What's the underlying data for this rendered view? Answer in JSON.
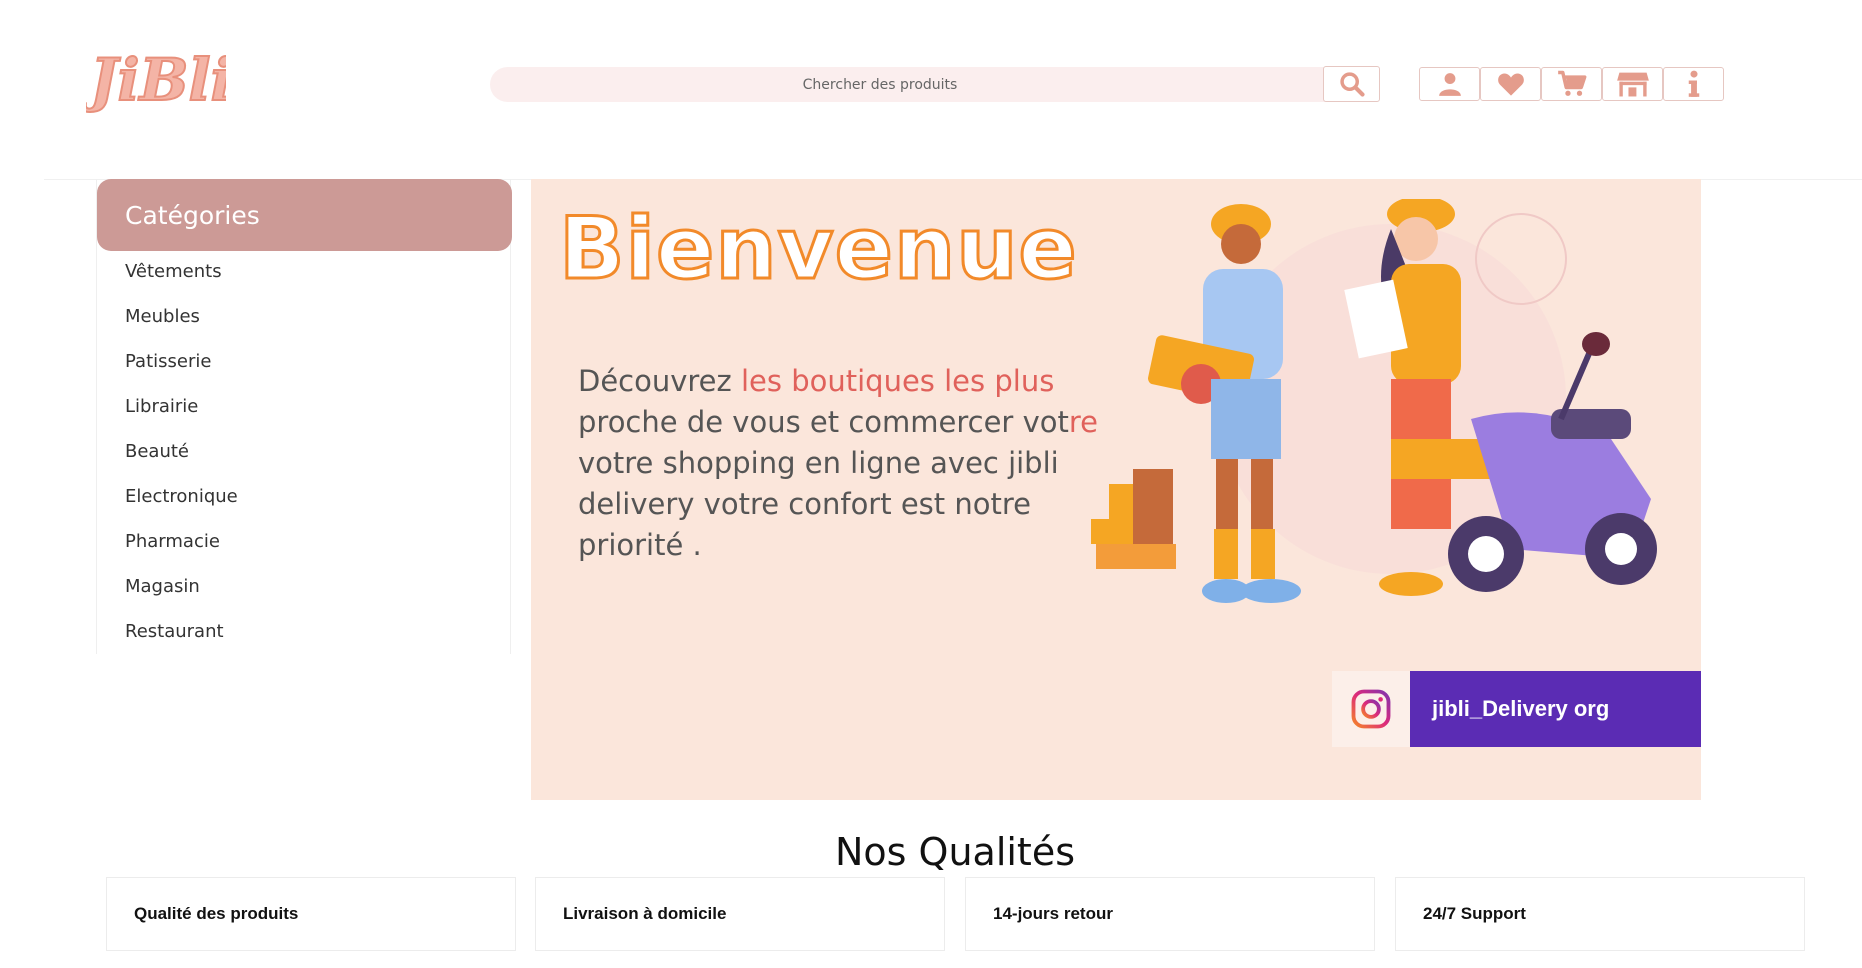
{
  "header": {
    "logo_text": "JiBli",
    "search_placeholder": "Chercher des produits",
    "icons": [
      "search-icon",
      "user-icon",
      "heart-icon",
      "cart-icon",
      "store-icon",
      "info-icon"
    ]
  },
  "sidebar": {
    "title": "Catégories",
    "items": [
      {
        "label": "Vêtements"
      },
      {
        "label": "Meubles"
      },
      {
        "label": "Patisserie"
      },
      {
        "label": "Librairie"
      },
      {
        "label": "Beauté"
      },
      {
        "label": "Electronique"
      },
      {
        "label": "Pharmacie"
      },
      {
        "label": "Magasin"
      },
      {
        "label": "Restaurant"
      }
    ]
  },
  "banner": {
    "title": "Bienvenue",
    "text_part1": "Découvrez ",
    "text_highlight": "les boutiques les plus",
    "text_part2": " proche de vous et commercer vot",
    "text_highlight2": "re",
    "text_part3": " votre shopping en ligne avec jibli delivery votre confort est notre priorité .",
    "social_handle": "jibli_Delivery org",
    "social_icon": "instagram-icon"
  },
  "qualities": {
    "title": "Nos Qualités",
    "cards": [
      {
        "label": "Qualité des produits"
      },
      {
        "label": "Livraison à domicile"
      },
      {
        "label": "14-jours retour"
      },
      {
        "label": "24/7 Support"
      }
    ]
  },
  "colors": {
    "accent": "#e49c8c",
    "category_header": "#cc9a96",
    "banner_bg": "#fbe6db",
    "instagram_bar": "#5b2cb4",
    "title_orange": "#f28a2a"
  }
}
